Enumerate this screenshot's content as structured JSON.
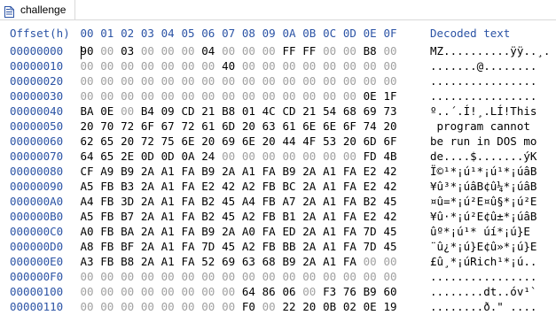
{
  "tab": {
    "title": "challenge",
    "icon": "hex-file-icon"
  },
  "header": {
    "offset_label": "Offset(h)",
    "columns": [
      "00",
      "01",
      "02",
      "03",
      "04",
      "05",
      "06",
      "07",
      "08",
      "09",
      "0A",
      "0B",
      "0C",
      "0D",
      "0E",
      "0F"
    ],
    "decoded_label": "Decoded text"
  },
  "colors": {
    "header": "#2b53a5",
    "zero_byte": "#a0a0a0",
    "byte": "#000000"
  },
  "rows": [
    {
      "offset": "00000000",
      "bytes": [
        "90",
        "00",
        "03",
        "00",
        "00",
        "00",
        "04",
        "00",
        "00",
        "00",
        "FF",
        "FF",
        "00",
        "00",
        "B8",
        "00"
      ],
      "text": "MZ..........ÿÿ..¸."
    },
    {
      "offset": "00000010",
      "bytes": [
        "00",
        "00",
        "00",
        "00",
        "00",
        "00",
        "00",
        "40",
        "00",
        "00",
        "00",
        "00",
        "00",
        "00",
        "00",
        "00"
      ],
      "text": ".......@........"
    },
    {
      "offset": "00000020",
      "bytes": [
        "00",
        "00",
        "00",
        "00",
        "00",
        "00",
        "00",
        "00",
        "00",
        "00",
        "00",
        "00",
        "00",
        "00",
        "00",
        "00"
      ],
      "text": "................"
    },
    {
      "offset": "00000030",
      "bytes": [
        "00",
        "00",
        "00",
        "00",
        "00",
        "00",
        "00",
        "00",
        "00",
        "00",
        "00",
        "00",
        "00",
        "00",
        "0E",
        "1F"
      ],
      "text": "................"
    },
    {
      "offset": "00000040",
      "bytes": [
        "BA",
        "0E",
        "00",
        "B4",
        "09",
        "CD",
        "21",
        "B8",
        "01",
        "4C",
        "CD",
        "21",
        "54",
        "68",
        "69",
        "73"
      ],
      "text": "º..´.Í!¸.LÍ!This"
    },
    {
      "offset": "00000050",
      "bytes": [
        "20",
        "70",
        "72",
        "6F",
        "67",
        "72",
        "61",
        "6D",
        "20",
        "63",
        "61",
        "6E",
        "6E",
        "6F",
        "74",
        "20"
      ],
      "text": " program cannot "
    },
    {
      "offset": "00000060",
      "bytes": [
        "62",
        "65",
        "20",
        "72",
        "75",
        "6E",
        "20",
        "69",
        "6E",
        "20",
        "44",
        "4F",
        "53",
        "20",
        "6D",
        "6F"
      ],
      "text": "be run in DOS mo"
    },
    {
      "offset": "00000070",
      "bytes": [
        "64",
        "65",
        "2E",
        "0D",
        "0D",
        "0A",
        "24",
        "00",
        "00",
        "00",
        "00",
        "00",
        "00",
        "00",
        "FD",
        "4B"
      ],
      "text": "de....$.......ýK"
    },
    {
      "offset": "00000080",
      "bytes": [
        "CF",
        "A9",
        "B9",
        "2A",
        "A1",
        "FA",
        "B9",
        "2A",
        "A1",
        "FA",
        "B9",
        "2A",
        "A1",
        "FA",
        "E2",
        "42"
      ],
      "text": "Ï©¹*¡ú¹*¡ú¹*¡úâB"
    },
    {
      "offset": "00000090",
      "bytes": [
        "A5",
        "FB",
        "B3",
        "2A",
        "A1",
        "FA",
        "E2",
        "42",
        "A2",
        "FB",
        "BC",
        "2A",
        "A1",
        "FA",
        "E2",
        "42"
      ],
      "text": "¥û³*¡úâB¢û¼*¡úâB"
    },
    {
      "offset": "000000A0",
      "bytes": [
        "A4",
        "FB",
        "3D",
        "2A",
        "A1",
        "FA",
        "B2",
        "45",
        "A4",
        "FB",
        "A7",
        "2A",
        "A1",
        "FA",
        "B2",
        "45"
      ],
      "text": "¤û=*¡ú²E¤û§*¡ú²E"
    },
    {
      "offset": "000000B0",
      "bytes": [
        "A5",
        "FB",
        "B7",
        "2A",
        "A1",
        "FA",
        "B2",
        "45",
        "A2",
        "FB",
        "B1",
        "2A",
        "A1",
        "FA",
        "E2",
        "42"
      ],
      "text": "¥û·*¡ú²E¢û±*¡úâB"
    },
    {
      "offset": "000000C0",
      "bytes": [
        "A0",
        "FB",
        "BA",
        "2A",
        "A1",
        "FA",
        "B9",
        "2A",
        "A0",
        "FA",
        "ED",
        "2A",
        "A1",
        "FA",
        "7D",
        "45"
      ],
      "text": "ûº*¡ú¹* úí*¡ú}E"
    },
    {
      "offset": "000000D0",
      "bytes": [
        "A8",
        "FB",
        "BF",
        "2A",
        "A1",
        "FA",
        "7D",
        "45",
        "A2",
        "FB",
        "BB",
        "2A",
        "A1",
        "FA",
        "7D",
        "45"
      ],
      "text": "¨û¿*¡ú}E¢û»*¡ú}E"
    },
    {
      "offset": "000000E0",
      "bytes": [
        "A3",
        "FB",
        "B8",
        "2A",
        "A1",
        "FA",
        "52",
        "69",
        "63",
        "68",
        "B9",
        "2A",
        "A1",
        "FA",
        "00",
        "00"
      ],
      "text": "£û¸*¡úRich¹*¡ú.."
    },
    {
      "offset": "000000F0",
      "bytes": [
        "00",
        "00",
        "00",
        "00",
        "00",
        "00",
        "00",
        "00",
        "00",
        "00",
        "00",
        "00",
        "00",
        "00",
        "00",
        "00"
      ],
      "text": "................"
    },
    {
      "offset": "00000100",
      "bytes": [
        "00",
        "00",
        "00",
        "00",
        "00",
        "00",
        "00",
        "00",
        "64",
        "86",
        "06",
        "00",
        "F3",
        "76",
        "B9",
        "60"
      ],
      "text": "........dt..óv¹`"
    },
    {
      "offset": "00000110",
      "bytes": [
        "00",
        "00",
        "00",
        "00",
        "00",
        "00",
        "00",
        "00",
        "F0",
        "00",
        "22",
        "20",
        "0B",
        "02",
        "0E",
        "19"
      ],
      "text": "........ð.\" ...."
    }
  ]
}
